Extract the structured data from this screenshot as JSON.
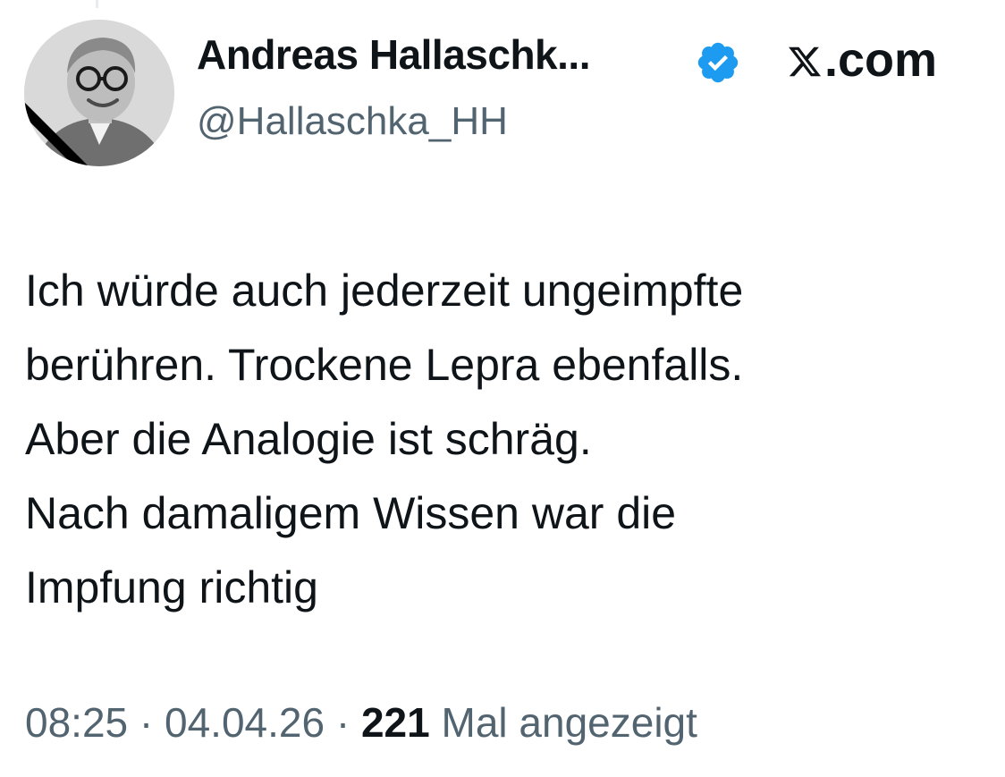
{
  "author": {
    "name": "Andreas Hallaschk...",
    "handle": "@Hallaschka_HH",
    "verified": true
  },
  "site": {
    "label": ".com",
    "logo": "x-logo-icon"
  },
  "tweet": {
    "lines": [
      "Ich würde auch jederzeit ungeimpfte",
      "berühren. Trockene Lepra ebenfalls.",
      "Aber die Analogie ist schräg.",
      "Nach damaligem Wissen war die",
      "Impfung richtig"
    ]
  },
  "meta": {
    "time": "08:25",
    "separator": "·",
    "date": "04.04.26",
    "views_count": "221",
    "views_label": "Mal angezeigt"
  },
  "colors": {
    "text_primary": "#0f1419",
    "text_secondary": "#536471",
    "verified_blue": "#1d9bf0",
    "background": "#ffffff"
  }
}
